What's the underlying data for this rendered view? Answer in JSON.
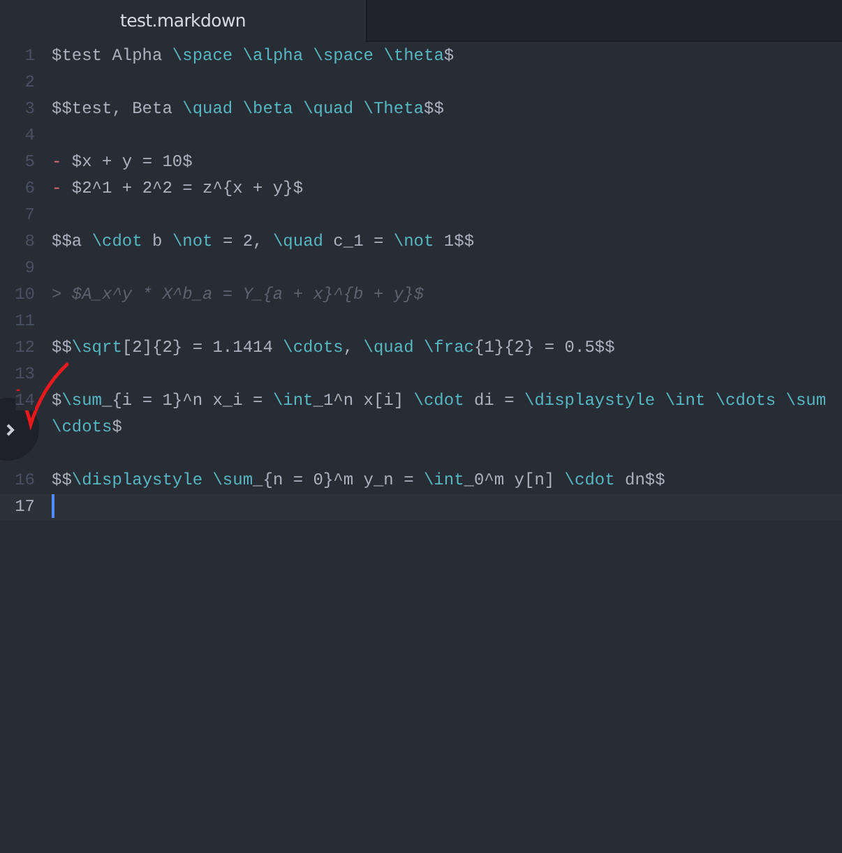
{
  "tab": {
    "title": "test.markdown",
    "selected": true
  },
  "lines": [
    {
      "number": "1",
      "tokens": [
        {
          "text": "$test Alpha ",
          "kind": "plain"
        },
        {
          "text": "\\space ",
          "kind": "command"
        },
        {
          "text": "\\alpha ",
          "kind": "command"
        },
        {
          "text": "\\space ",
          "kind": "command"
        },
        {
          "text": "\\theta",
          "kind": "command"
        },
        {
          "text": "$",
          "kind": "plain"
        }
      ]
    },
    {
      "number": "2"
    },
    {
      "number": "3",
      "tokens": [
        {
          "text": "$$test, Beta ",
          "kind": "plain"
        },
        {
          "text": "\\quad ",
          "kind": "command"
        },
        {
          "text": "\\beta ",
          "kind": "command"
        },
        {
          "text": "\\quad ",
          "kind": "command"
        },
        {
          "text": "\\Theta",
          "kind": "command"
        },
        {
          "text": "$$",
          "kind": "plain"
        }
      ]
    },
    {
      "number": "4"
    },
    {
      "number": "5",
      "tokens": [
        {
          "text": "- ",
          "kind": "marker"
        },
        {
          "text": "$x + y = 10$",
          "kind": "plain"
        }
      ]
    },
    {
      "number": "6",
      "tokens": [
        {
          "text": "- ",
          "kind": "marker"
        },
        {
          "text": "$2^1 + 2^2 = z^{x + y}$",
          "kind": "plain"
        }
      ]
    },
    {
      "number": "7"
    },
    {
      "number": "8",
      "tokens": [
        {
          "text": "$$a ",
          "kind": "plain"
        },
        {
          "text": "\\cdot",
          "kind": "command"
        },
        {
          "text": " b ",
          "kind": "plain"
        },
        {
          "text": "\\not",
          "kind": "command"
        },
        {
          "text": " = 2, ",
          "kind": "plain"
        },
        {
          "text": "\\quad",
          "kind": "command"
        },
        {
          "text": " c_1 = ",
          "kind": "plain"
        },
        {
          "text": "\\not",
          "kind": "command"
        },
        {
          "text": " 1$$",
          "kind": "plain"
        }
      ]
    },
    {
      "number": "9"
    },
    {
      "number": "10",
      "tokens": [
        {
          "text": "> $A_x^y * X^b_a = Y_{a + x}^{b + y}$",
          "kind": "quote"
        }
      ]
    },
    {
      "number": "11"
    },
    {
      "number": "12",
      "tokens": [
        {
          "text": "$$",
          "kind": "plain"
        },
        {
          "text": "\\sqrt",
          "kind": "command"
        },
        {
          "text": "[2]{2} = 1.1414 ",
          "kind": "plain"
        },
        {
          "text": "\\cdots",
          "kind": "command"
        },
        {
          "text": ", ",
          "kind": "plain"
        },
        {
          "text": "\\quad ",
          "kind": "command"
        },
        {
          "text": "\\frac",
          "kind": "command"
        },
        {
          "text": "{1}{2} = 0.5$$",
          "kind": "plain"
        }
      ]
    },
    {
      "number": "13"
    },
    {
      "number": "14",
      "tokens": [
        {
          "text": "$",
          "kind": "plain"
        },
        {
          "text": "\\sum",
          "kind": "command"
        },
        {
          "text": "_{i = 1}^n x_i = ",
          "kind": "plain"
        },
        {
          "text": "\\int",
          "kind": "command"
        },
        {
          "text": "_1^n x[i] ",
          "kind": "plain"
        },
        {
          "text": "\\cdot",
          "kind": "command"
        },
        {
          "text": " di = ",
          "kind": "plain"
        },
        {
          "text": "\\displaystyle ",
          "kind": "command"
        },
        {
          "text": "\\int ",
          "kind": "command"
        },
        {
          "text": "\\cdots ",
          "kind": "command"
        },
        {
          "text": "\\sum ",
          "kind": "command"
        },
        {
          "text": "\\cdots",
          "kind": "command"
        },
        {
          "text": "$",
          "kind": "plain"
        }
      ]
    },
    {
      "kind": "blank"
    },
    {
      "number": "16",
      "tokens": [
        {
          "text": "$$",
          "kind": "plain"
        },
        {
          "text": "\\displaystyle ",
          "kind": "command"
        },
        {
          "text": "\\sum",
          "kind": "command"
        },
        {
          "text": "_{n = 0}^m y_n = ",
          "kind": "plain"
        },
        {
          "text": "\\int",
          "kind": "command"
        },
        {
          "text": "_0^m y[n] ",
          "kind": "plain"
        },
        {
          "text": "\\cdot",
          "kind": "command"
        },
        {
          "text": " dn$$",
          "kind": "plain"
        }
      ]
    },
    {
      "number": "17",
      "current": true
    }
  ]
}
